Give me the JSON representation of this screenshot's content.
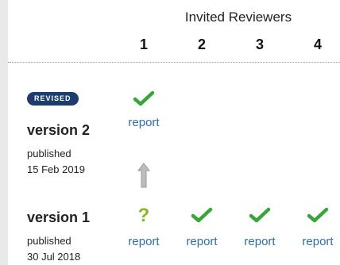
{
  "header": {
    "title": "Invited Reviewers",
    "reviewer_numbers": [
      "1",
      "2",
      "3",
      "4"
    ]
  },
  "versions": [
    {
      "badge": "REVISED",
      "title": "version 2",
      "published_label": "published",
      "published_date": "15 Feb 2019",
      "reports": [
        {
          "status": "approved",
          "status_icon": "check-icon",
          "link_label": "report"
        }
      ]
    },
    {
      "title": "version 1",
      "published_label": "published",
      "published_date": "30 Jul 2018",
      "reports": [
        {
          "status": "reservations",
          "status_icon": "question-mark-icon",
          "link_label": "report"
        },
        {
          "status": "approved",
          "status_icon": "check-icon",
          "link_label": "report"
        },
        {
          "status": "approved",
          "status_icon": "check-icon",
          "link_label": "report"
        },
        {
          "status": "approved",
          "status_icon": "check-icon",
          "link_label": "report"
        }
      ]
    }
  ],
  "colors": {
    "approved": "#3aa53a",
    "reservations": "#86b827",
    "badge": "#1c3d6e",
    "link": "#2f6da8",
    "arrow": "#b0b0b0"
  }
}
